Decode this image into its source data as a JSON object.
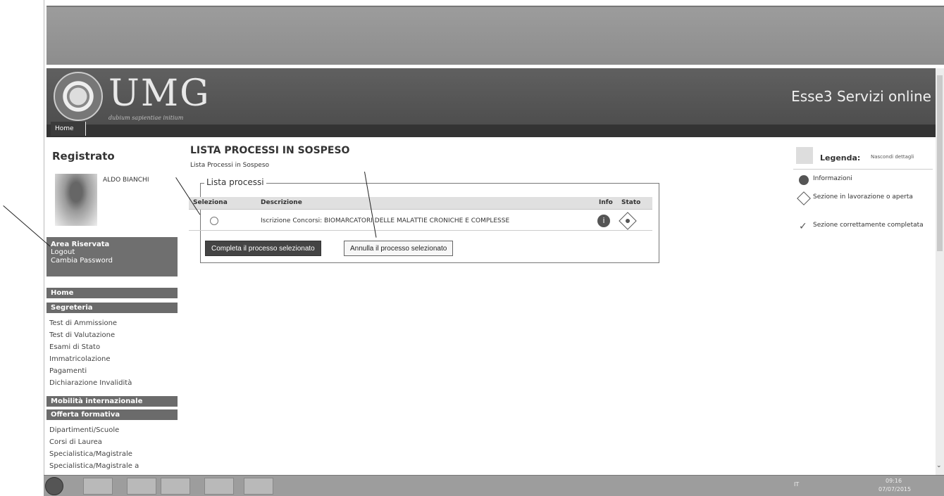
{
  "header": {
    "logo_text": "UMG",
    "logo_motto": "dubium sapientiae initium",
    "service_title": "Esse3 Servizi online",
    "home_tab": "Home"
  },
  "sidebar": {
    "heading": "Registrato",
    "user_name": "ALDO BIANCHI",
    "area_title": "Area Riservata",
    "area_links": [
      "Logout",
      "Cambia Password"
    ],
    "nav_sections": [
      "Home",
      "Segreteria",
      "Mobilità internazionale",
      "Offerta formativa"
    ],
    "segreteria_links": [
      "Test di Ammissione",
      "Test di Valutazione",
      "Esami di Stato",
      "Immatricolazione",
      "Pagamenti",
      "Dichiarazione Invalidità"
    ],
    "offerta_links": [
      "Dipartimenti/Scuole",
      "Corsi di Laurea",
      "Specialistica/Magistrale",
      "Specialistica/Magistrale a"
    ]
  },
  "main": {
    "title": "LISTA PROCESSI IN SOSPESO",
    "subtitle": "Lista Processi in Sospeso",
    "fieldset_label": "Lista processi",
    "columns": {
      "select": "Seleziona",
      "description": "Descrizione",
      "info": "Info",
      "status": "Stato"
    },
    "rows": [
      {
        "description": "Iscrizione Concorsi: BIOMARCATORI DELLE MALATTIE CRONICHE E COMPLESSE",
        "info_icon": "info-icon",
        "status_icon": "in-progress-icon"
      }
    ],
    "primary_button": "Completa il processo selezionato",
    "secondary_button": "Annulla il processo selezionato"
  },
  "legend": {
    "title": "Legenda:",
    "toggle": "Nascondi dettagli",
    "items": [
      {
        "icon": "info-icon",
        "text": "Informazioni"
      },
      {
        "icon": "in-progress-icon",
        "text": "Sezione in lavorazione o aperta"
      },
      {
        "icon": "check-icon",
        "text": "Sezione correttamente completata"
      }
    ]
  },
  "taskbar": {
    "language": "IT",
    "time": "09:16",
    "date": "07/07/2015"
  }
}
